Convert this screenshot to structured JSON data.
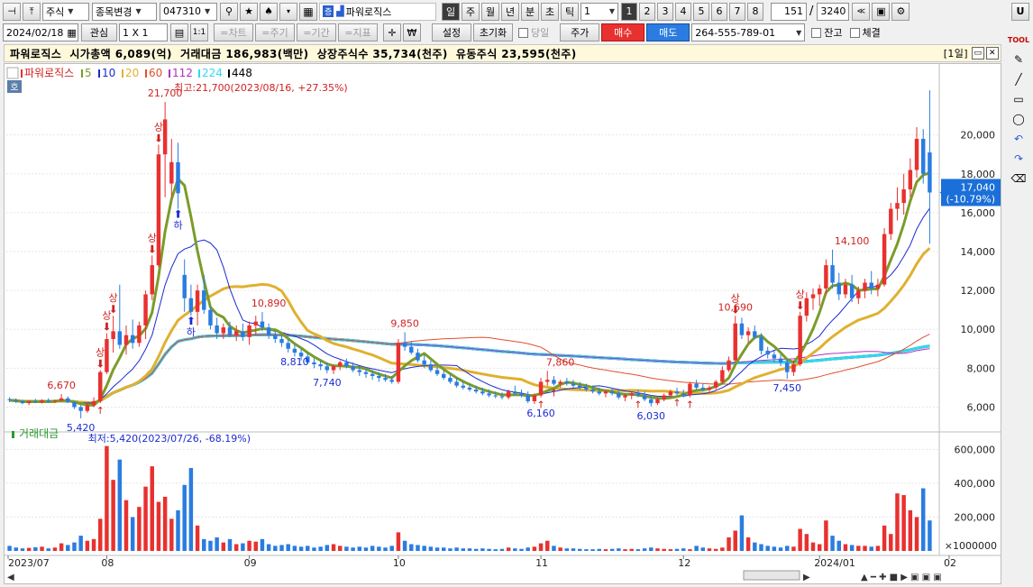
{
  "toolbar": {
    "market": "주식",
    "change_label": "종목변경",
    "code": "047310",
    "stock_name": "파워로직스",
    "periods": [
      "일",
      "주",
      "월",
      "년",
      "분",
      "초",
      "틱"
    ],
    "interval": "1",
    "num_buttons": [
      "1",
      "2",
      "3",
      "4",
      "5",
      "6",
      "7",
      "8"
    ],
    "count": "151",
    "slash": "/",
    "total": "3240",
    "u_label": "U"
  },
  "toolbar2": {
    "date": "2024/02/18",
    "watch": "관심",
    "ratio": "1 X 1",
    "one_one": "1:1",
    "chart": "=차트",
    "cycle": "=주기",
    "period": "=기간",
    "indicator": "=지표",
    "won": "₩",
    "settings": "설정",
    "reset": "초기화",
    "today": "당일",
    "price": "주가",
    "buy": "매수",
    "sell": "매도",
    "account": "264-555-789-01",
    "balance": "잔고",
    "fill": "체결"
  },
  "info": {
    "text": "파워로직스  시가총액 6,089(억)  거래대금 186,983(백만)  상장주식수 35,734(천주)  유동주식 23,595(천주)",
    "period_tag": "[1일]"
  },
  "chart_data": [
    {
      "type": "candlestick",
      "legend": [
        {
          "name": "파워로직스",
          "color": "#e8312f"
        },
        {
          "name": "5",
          "color": "#7a9c2a"
        },
        {
          "name": "10",
          "color": "#1b2bd0"
        },
        {
          "name": "20",
          "color": "#e0b030"
        },
        {
          "name": "60",
          "color": "#e05030"
        },
        {
          "name": "112",
          "color": "#b030c0"
        },
        {
          "name": "224",
          "color": "#30d8f0"
        },
        {
          "name": "448",
          "color": "#000000"
        }
      ],
      "ho_badge": "호",
      "ylim": [
        5000,
        23000
      ],
      "y_ticks": [
        6000,
        8000,
        10000,
        12000,
        14000,
        16000,
        18000,
        20000
      ],
      "y_tick_labels": [
        "6,000",
        "8,000",
        "10,000",
        "12,000",
        "14,000",
        "16,000",
        "18,000",
        "20,000"
      ],
      "x_labels": [
        "2023/07",
        "08",
        "09",
        "10",
        "11",
        "12",
        "2024/01",
        "02"
      ],
      "current_price": "17,040",
      "current_change": "(-10.79%)",
      "high_note": "최고:21,700(2023/08/16, +27.35%)",
      "low_note": "최저:5,420(2023/07/26, -68.19%)",
      "annotations": [
        {
          "text": "6,670",
          "value": 6670,
          "color": "#d02020"
        },
        {
          "text": "5,420",
          "value": 5420,
          "color": "#1b2bd0"
        },
        {
          "text": "21,700",
          "value": 21700,
          "color": "#d02020"
        },
        {
          "text": "10,890",
          "value": 10890,
          "color": "#d02020"
        },
        {
          "text": "8,810",
          "value": 8810,
          "color": "#1b2bd0"
        },
        {
          "text": "7,740",
          "value": 7740,
          "color": "#1b2bd0"
        },
        {
          "text": "9,850",
          "value": 9850,
          "color": "#d02020"
        },
        {
          "text": "7,860",
          "value": 7860,
          "color": "#d02020"
        },
        {
          "text": "6,160",
          "value": 6160,
          "color": "#1b2bd0"
        },
        {
          "text": "6,030",
          "value": 6030,
          "color": "#1b2bd0"
        },
        {
          "text": "10,690",
          "value": 10690,
          "color": "#d02020"
        },
        {
          "text": "7,450",
          "value": 7450,
          "color": "#1b2bd0"
        },
        {
          "text": "14,100",
          "value": 14100,
          "color": "#d02020"
        }
      ],
      "sang_label": "상",
      "ha_label": "하",
      "candles": [
        [
          6400,
          6500,
          6250,
          6350
        ],
        [
          6350,
          6450,
          6200,
          6300
        ],
        [
          6300,
          6380,
          6150,
          6200
        ],
        [
          6200,
          6350,
          6100,
          6300
        ],
        [
          6300,
          6420,
          6200,
          6250
        ],
        [
          6250,
          6400,
          6180,
          6350
        ],
        [
          6350,
          6450,
          6250,
          6280
        ],
        [
          6280,
          6380,
          6200,
          6330
        ],
        [
          6330,
          6670,
          6300,
          6450
        ],
        [
          6450,
          6550,
          6200,
          6250
        ],
        [
          6250,
          6300,
          5900,
          6000
        ],
        [
          6000,
          6100,
          5420,
          5800
        ],
        [
          5800,
          6200,
          5700,
          6100
        ],
        [
          6100,
          6500,
          6000,
          6300
        ],
        [
          6300,
          7900,
          6200,
          7800
        ],
        [
          7800,
          9800,
          7700,
          9500
        ],
        [
          9500,
          10700,
          8800,
          9900
        ],
        [
          9900,
          12300,
          9000,
          9200
        ],
        [
          9200,
          10200,
          8700,
          9700
        ],
        [
          9700,
          10500,
          9000,
          9300
        ],
        [
          9300,
          10400,
          9100,
          10200
        ],
        [
          10200,
          12000,
          9500,
          11800
        ],
        [
          11800,
          13800,
          11500,
          13300
        ],
        [
          13300,
          19500,
          13200,
          19000
        ],
        [
          19000,
          21700,
          16800,
          20800
        ],
        [
          17500,
          19800,
          16800,
          18600
        ],
        [
          18600,
          19600,
          16200,
          17000
        ],
        [
          12800,
          13600,
          10900,
          11600
        ],
        [
          11600,
          12300,
          10700,
          10900
        ],
        [
          10900,
          12300,
          10200,
          12000
        ],
        [
          12000,
          12800,
          10800,
          11000
        ],
        [
          11000,
          11200,
          10000,
          10200
        ],
        [
          10200,
          10600,
          9500,
          9800
        ],
        [
          9800,
          10300,
          9500,
          10100
        ],
        [
          10100,
          10400,
          9600,
          9700
        ],
        [
          9700,
          10200,
          9400,
          9900
        ],
        [
          9900,
          10300,
          9400,
          9600
        ],
        [
          9600,
          10400,
          9200,
          10200
        ],
        [
          10200,
          10700,
          9700,
          10400
        ],
        [
          10400,
          10890,
          9900,
          10100
        ],
        [
          10100,
          10300,
          9500,
          9700
        ],
        [
          9700,
          9900,
          9300,
          9500
        ],
        [
          9500,
          9700,
          9100,
          9300
        ],
        [
          9300,
          9500,
          8810,
          9000
        ],
        [
          9000,
          9200,
          8600,
          8800
        ],
        [
          8800,
          9000,
          8400,
          8600
        ],
        [
          8600,
          8800,
          8200,
          8300
        ],
        [
          8300,
          8500,
          8000,
          8200
        ],
        [
          8200,
          8400,
          7900,
          8100
        ],
        [
          8100,
          8300,
          7740,
          7900
        ],
        [
          7900,
          8200,
          7700,
          8100
        ],
        [
          8100,
          8400,
          7900,
          8300
        ],
        [
          8300,
          8500,
          8000,
          8100
        ],
        [
          8100,
          8300,
          7800,
          7900
        ],
        [
          7900,
          8100,
          7600,
          7800
        ],
        [
          7800,
          8000,
          7500,
          7700
        ],
        [
          7700,
          7900,
          7400,
          7600
        ],
        [
          7600,
          7800,
          7300,
          7500
        ],
        [
          7500,
          7700,
          7300,
          7400
        ],
        [
          7400,
          7600,
          7200,
          7300
        ],
        [
          7300,
          9500,
          7200,
          9300
        ],
        [
          9300,
          9850,
          8900,
          9100
        ],
        [
          9100,
          9400,
          8700,
          8800
        ],
        [
          8800,
          9000,
          8300,
          8400
        ],
        [
          8400,
          8700,
          8000,
          8200
        ],
        [
          8200,
          8400,
          7800,
          7900
        ],
        [
          7900,
          8100,
          7600,
          7700
        ],
        [
          7700,
          7900,
          7400,
          7500
        ],
        [
          7500,
          7700,
          7200,
          7300
        ],
        [
          7300,
          7500,
          7000,
          7100
        ],
        [
          7100,
          7300,
          6900,
          7000
        ],
        [
          7000,
          7200,
          6800,
          6900
        ],
        [
          6900,
          7100,
          6700,
          6800
        ],
        [
          6800,
          7000,
          6600,
          6700
        ],
        [
          6700,
          6900,
          6500,
          6600
        ],
        [
          6600,
          6800,
          6450,
          6550
        ],
        [
          6550,
          6750,
          6400,
          6500
        ],
        [
          6500,
          6900,
          6400,
          6800
        ],
        [
          6800,
          7100,
          6600,
          6700
        ],
        [
          6700,
          6900,
          6500,
          6600
        ],
        [
          6600,
          6800,
          6200,
          6300
        ],
        [
          6300,
          6700,
          6160,
          6600
        ],
        [
          6600,
          7500,
          6500,
          7300
        ],
        [
          7300,
          7860,
          7100,
          7400
        ],
        [
          7400,
          7600,
          7100,
          7200
        ],
        [
          7200,
          7400,
          7000,
          7300
        ],
        [
          7300,
          7500,
          7100,
          7200
        ],
        [
          7200,
          7400,
          7000,
          7100
        ],
        [
          7100,
          7300,
          6900,
          7000
        ],
        [
          7000,
          7200,
          6800,
          6900
        ],
        [
          6900,
          7100,
          6700,
          6800
        ],
        [
          6800,
          7000,
          6600,
          6700
        ],
        [
          6700,
          6900,
          6500,
          6800
        ],
        [
          6800,
          7000,
          6600,
          6700
        ],
        [
          6700,
          6900,
          6400,
          6500
        ],
        [
          6500,
          6700,
          6300,
          6600
        ],
        [
          6600,
          6800,
          6400,
          6700
        ],
        [
          6700,
          6900,
          6500,
          6600
        ],
        [
          6600,
          6800,
          6300,
          6400
        ],
        [
          6400,
          6600,
          6030,
          6200
        ],
        [
          6200,
          6500,
          6100,
          6400
        ],
        [
          6400,
          6700,
          6300,
          6600
        ],
        [
          6600,
          6900,
          6500,
          6800
        ],
        [
          6800,
          7000,
          6600,
          6700
        ],
        [
          6700,
          6900,
          6500,
          6600
        ],
        [
          6600,
          7300,
          6500,
          7200
        ],
        [
          7200,
          7400,
          6900,
          7000
        ],
        [
          7000,
          7200,
          6800,
          6900
        ],
        [
          6900,
          7100,
          6700,
          7000
        ],
        [
          7000,
          7400,
          6900,
          7300
        ],
        [
          7300,
          8100,
          7200,
          7900
        ],
        [
          7900,
          8600,
          7800,
          8400
        ],
        [
          8400,
          10690,
          8300,
          10300
        ],
        [
          10300,
          10600,
          9500,
          9700
        ],
        [
          9700,
          10100,
          9300,
          9900
        ],
        [
          9900,
          10200,
          9500,
          9600
        ],
        [
          9600,
          9800,
          8700,
          8900
        ],
        [
          8900,
          9100,
          8500,
          8700
        ],
        [
          8700,
          8900,
          8300,
          8500
        ],
        [
          8500,
          8700,
          8100,
          8300
        ],
        [
          8300,
          8500,
          7450,
          7800
        ],
        [
          7800,
          8400,
          7600,
          8200
        ],
        [
          8200,
          10900,
          8100,
          10700
        ],
        [
          10700,
          11900,
          10400,
          11600
        ],
        [
          11600,
          12100,
          11000,
          11800
        ],
        [
          11800,
          12300,
          11200,
          12100
        ],
        [
          12100,
          13600,
          11800,
          13300
        ],
        [
          13300,
          14100,
          12100,
          12400
        ],
        [
          12400,
          12900,
          11500,
          11800
        ],
        [
          11800,
          12600,
          11600,
          12300
        ],
        [
          12300,
          12800,
          11400,
          11600
        ],
        [
          11600,
          12200,
          11300,
          12000
        ],
        [
          12000,
          12600,
          11600,
          12400
        ],
        [
          12400,
          13000,
          11800,
          12100
        ],
        [
          12100,
          12600,
          11700,
          12300
        ],
        [
          12300,
          15200,
          12200,
          14900
        ],
        [
          14900,
          16500,
          14600,
          16200
        ],
        [
          16200,
          17300,
          15600,
          16500
        ],
        [
          16500,
          18000,
          15900,
          17200
        ],
        [
          17200,
          18800,
          16800,
          18200
        ],
        [
          18200,
          20400,
          17800,
          19800
        ],
        [
          19800,
          20300,
          17500,
          18000
        ],
        [
          19100,
          22300,
          14400,
          17040
        ]
      ],
      "volume": {
        "label": "거래대금",
        "unit": "×1000000",
        "ylim": [
          0,
          650000
        ],
        "y_ticks": [
          200000,
          400000,
          600000
        ],
        "y_tick_labels": [
          "200,000",
          "400,000",
          "600,000"
        ],
        "values": [
          30000,
          20000,
          15000,
          18000,
          22000,
          25000,
          15000,
          20000,
          45000,
          35000,
          50000,
          90000,
          60000,
          70000,
          190000,
          620000,
          420000,
          540000,
          300000,
          200000,
          260000,
          380000,
          500000,
          290000,
          320000,
          190000,
          240000,
          390000,
          490000,
          150000,
          70000,
          60000,
          80000,
          50000,
          70000,
          40000,
          45000,
          60000,
          55000,
          70000,
          40000,
          30000,
          35000,
          40000,
          30000,
          25000,
          30000,
          20000,
          25000,
          35000,
          40000,
          30000,
          25000,
          20000,
          25000,
          20000,
          30000,
          25000,
          20000,
          30000,
          110000,
          60000,
          40000,
          35000,
          30000,
          25000,
          20000,
          20000,
          15000,
          20000,
          15000,
          15000,
          12000,
          15000,
          12000,
          10000,
          12000,
          20000,
          15000,
          12000,
          20000,
          25000,
          45000,
          60000,
          30000,
          20000,
          15000,
          15000,
          12000,
          10000,
          10000,
          12000,
          10000,
          12000,
          15000,
          10000,
          12000,
          10000,
          15000,
          20000,
          15000,
          12000,
          10000,
          12000,
          15000,
          10000,
          30000,
          20000,
          15000,
          12000,
          20000,
          80000,
          120000,
          210000,
          80000,
          50000,
          40000,
          30000,
          25000,
          20000,
          30000,
          25000,
          130000,
          100000,
          50000,
          40000,
          180000,
          90000,
          60000,
          40000,
          35000,
          30000,
          30000,
          25000,
          30000,
          150000,
          100000,
          340000,
          330000,
          240000,
          200000,
          370000,
          180000
        ]
      }
    }
  ]
}
